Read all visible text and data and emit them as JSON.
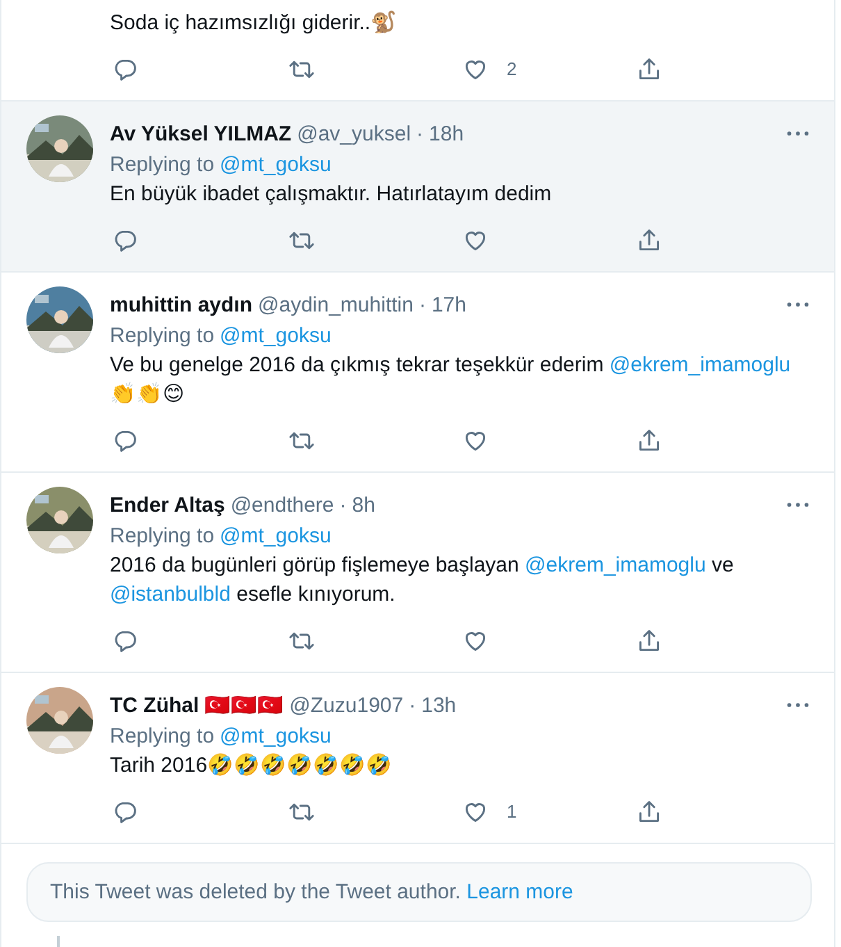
{
  "tweets": [
    {
      "highlighted": false,
      "text": [
        {
          "kind": "plain",
          "text": "Soda iç hazımsızlığı giderir..🐒"
        }
      ],
      "likes": "2"
    },
    {
      "highlighted": true,
      "name": "Av Yüksel YILMAZ",
      "handle": "@av_yuksel",
      "separator": "·",
      "time": "18h",
      "replying_label": "Replying to",
      "replying_to": "@mt_goksu",
      "text": [
        {
          "kind": "plain",
          "text": "En büyük ibadet çalışmaktır. Hatırlatayım dedim"
        }
      ]
    },
    {
      "highlighted": false,
      "name": "muhittin aydın",
      "handle": "@aydin_muhittin",
      "separator": "·",
      "time": "17h",
      "replying_label": "Replying to",
      "replying_to": "@mt_goksu",
      "text": [
        {
          "kind": "plain",
          "text": "Ve bu genelge 2016 da çıkmış tekrar teşekkür ederim "
        },
        {
          "kind": "mention",
          "text": "@ekrem_imamoglu"
        },
        {
          "kind": "plain",
          "text": " 👏👏😊"
        }
      ]
    },
    {
      "highlighted": false,
      "name": "Ender Altaş",
      "handle": "@endthere",
      "separator": "·",
      "time": "8h",
      "replying_label": "Replying to",
      "replying_to": "@mt_goksu",
      "text": [
        {
          "kind": "plain",
          "text": "2016 da bugünleri görüp fişlemeye başlayan "
        },
        {
          "kind": "mention",
          "text": "@ekrem_imamoglu"
        },
        {
          "kind": "plain",
          "text": " ve "
        },
        {
          "kind": "mention",
          "text": "@istanbulbld"
        },
        {
          "kind": "plain",
          "text": " esefle kınıyorum."
        }
      ]
    },
    {
      "highlighted": false,
      "name": "TC Zühal",
      "flags": "🇹🇷🇹🇷🇹🇷",
      "handle": "@Zuzu1907",
      "separator": "·",
      "time": "13h",
      "replying_label": "Replying to",
      "replying_to": "@mt_goksu",
      "text": [
        {
          "kind": "plain",
          "text": "Tarih 2016🤣🤣🤣🤣🤣🤣🤣"
        }
      ],
      "likes": "1"
    }
  ],
  "deleted_notice": {
    "text": "This Tweet was deleted by the Tweet author.",
    "link": "Learn more"
  }
}
